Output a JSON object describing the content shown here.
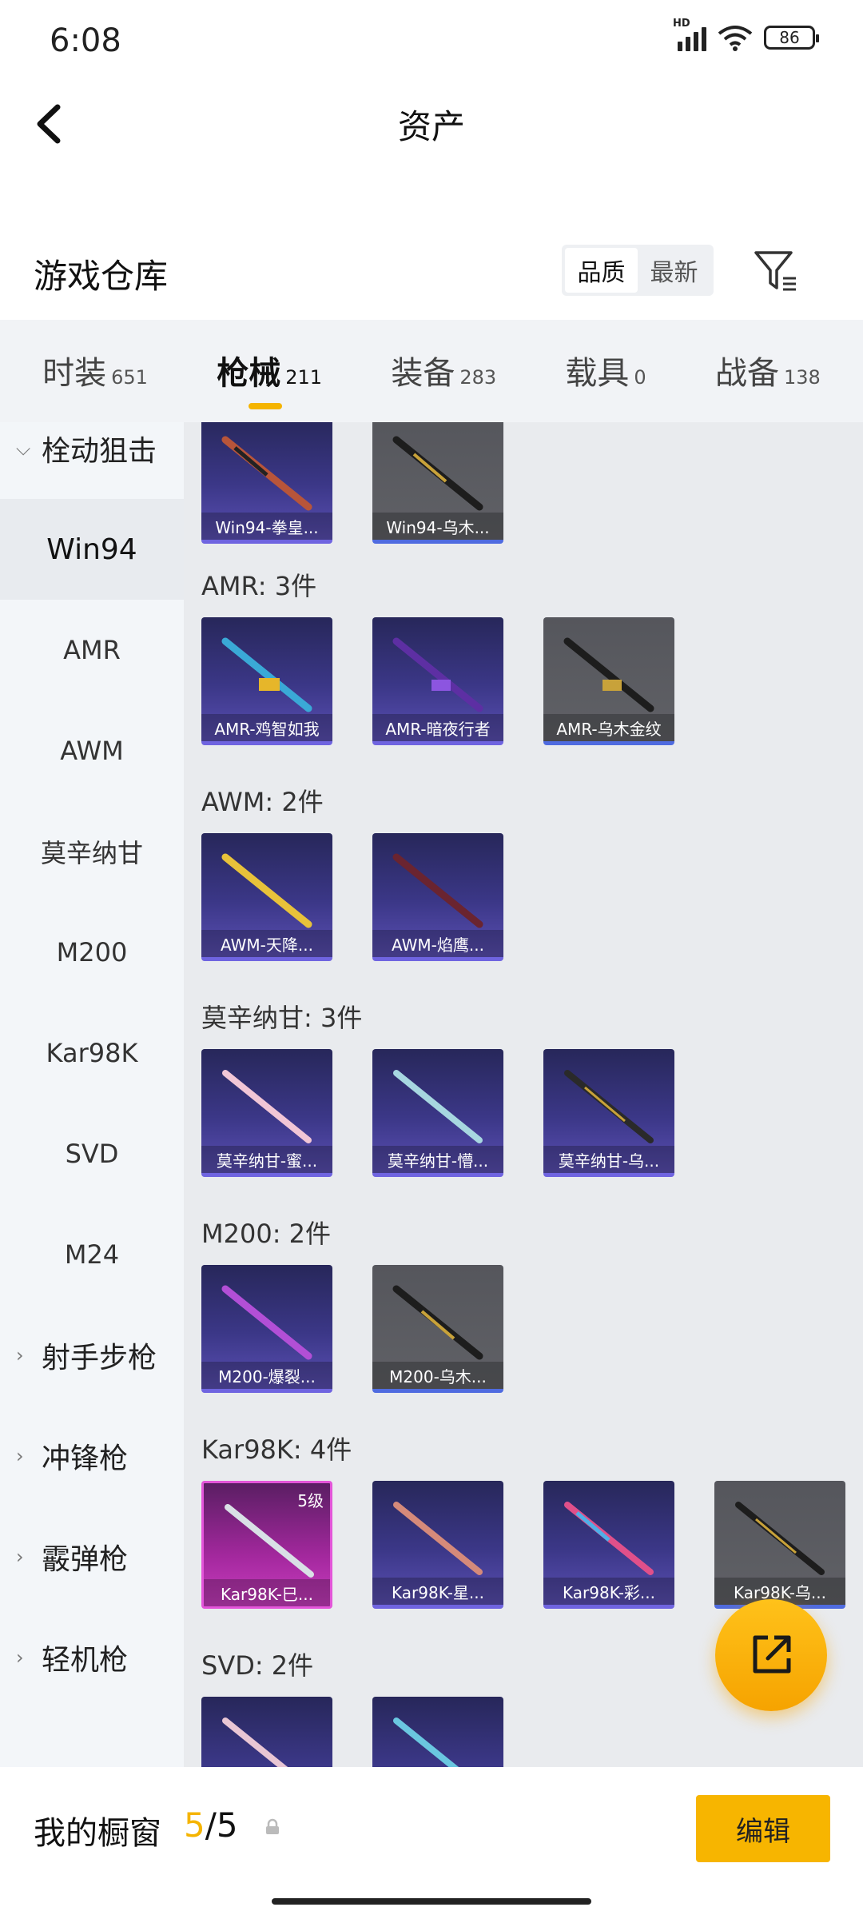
{
  "status": {
    "time": "6:08",
    "network": "HD",
    "battery": "86"
  },
  "header": {
    "title": "资产"
  },
  "warehouse": {
    "title": "游戏仓库",
    "sort_quality": "品质",
    "sort_newest": "最新"
  },
  "tabs": [
    {
      "label": "时装",
      "count": "651"
    },
    {
      "label": "枪械",
      "count": "211"
    },
    {
      "label": "装备",
      "count": "283"
    },
    {
      "label": "载具",
      "count": "0"
    },
    {
      "label": "战备",
      "count": "138"
    }
  ],
  "sidebar": {
    "cat_sniper": "栓动狙击",
    "items": [
      "Win94",
      "AMR",
      "AWM",
      "莫辛纳甘",
      "M200",
      "Kar98K",
      "SVD",
      "M24"
    ],
    "cats": [
      "射手步枪",
      "冲锋枪",
      "霰弹枪",
      "轻机枪"
    ]
  },
  "groups": {
    "win94": {
      "items": [
        "Win94-拳皇...",
        "Win94-乌木..."
      ]
    },
    "amr": {
      "title": "AMR: 3件",
      "items": [
        "AMR-鸡智如我",
        "AMR-暗夜行者",
        "AMR-乌木金纹"
      ]
    },
    "awm": {
      "title": "AWM: 2件",
      "items": [
        "AWM-天降...",
        "AWM-焰鹰..."
      ]
    },
    "mosin": {
      "title": "莫辛纳甘: 3件",
      "items": [
        "莫辛纳甘-蜜...",
        "莫辛纳甘-懵...",
        "莫辛纳甘-乌..."
      ]
    },
    "m200": {
      "title": "M200: 2件",
      "items": [
        "M200-爆裂...",
        "M200-乌木..."
      ]
    },
    "kar": {
      "title": "Kar98K: 4件",
      "badge": "5级",
      "items": [
        "Kar98K-巳...",
        "Kar98K-星...",
        "Kar98K-彩...",
        "Kar98K-乌..."
      ]
    },
    "svd": {
      "title": "SVD: 2件"
    }
  },
  "bottom": {
    "label": "我的橱窗",
    "current": "5",
    "total": "/5",
    "edit": "编辑"
  },
  "colors": {
    "accent": "#f5b400",
    "purple_card": "#3b3787",
    "pink_card": "#a4289e"
  }
}
